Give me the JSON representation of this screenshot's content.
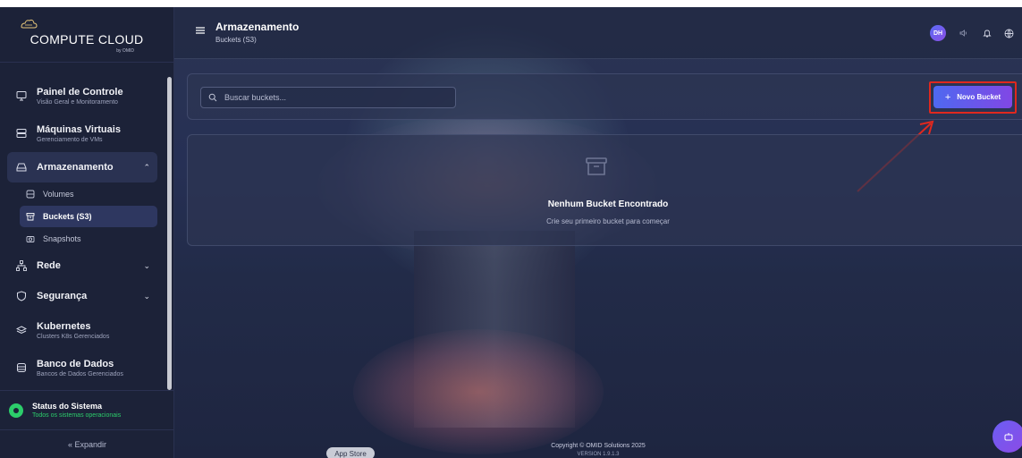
{
  "brand": {
    "name": "COMPUTE CLOUD",
    "byline": "by OMID"
  },
  "header": {
    "title": "Armazenamento",
    "subtitle": "Buckets (S3)",
    "avatar": "DH"
  },
  "sidebar": {
    "items": [
      {
        "title": "Painel de Controle",
        "subtitle": "Visão Geral e Monitoramento",
        "icon": "monitor-icon"
      },
      {
        "title": "Máquinas Virtuais",
        "subtitle": "Gerenciamento de VMs",
        "icon": "server-icon"
      },
      {
        "title": "Armazenamento",
        "icon": "storage-icon",
        "expanded": true,
        "children": [
          {
            "label": "Volumes",
            "icon": "database-icon"
          },
          {
            "label": "Buckets (S3)",
            "icon": "bucket-icon",
            "active": true
          },
          {
            "label": "Snapshots",
            "icon": "camera-icon"
          }
        ]
      },
      {
        "title": "Rede",
        "icon": "network-icon"
      },
      {
        "title": "Segurança",
        "icon": "shield-icon"
      },
      {
        "title": "Kubernetes",
        "subtitle": "Clusters K8s Gerenciados",
        "icon": "layers-icon"
      },
      {
        "title": "Banco de Dados",
        "subtitle": "Bancos de Dados Gerenciados",
        "icon": "db-icon"
      }
    ],
    "status": {
      "title": "Status do Sistema",
      "subtitle": "Todos os sistemas operacionais"
    },
    "expand_label": "« Expandir"
  },
  "toolbar": {
    "search_placeholder": "Buscar buckets...",
    "new_bucket_label": "Novo Bucket"
  },
  "empty_state": {
    "title": "Nenhum Bucket Encontrado",
    "subtitle": "Crie seu primeiro bucket para começar"
  },
  "footer": {
    "copyright": "Copyright © OMID Solutions 2025",
    "version": "VERSION 1.9.1.3",
    "app_store": "App Store"
  },
  "colors": {
    "accent_start": "#4e69f0",
    "accent_end": "#8147e5",
    "status_green": "#2ccd6b",
    "highlight_red": "#e0281e"
  }
}
